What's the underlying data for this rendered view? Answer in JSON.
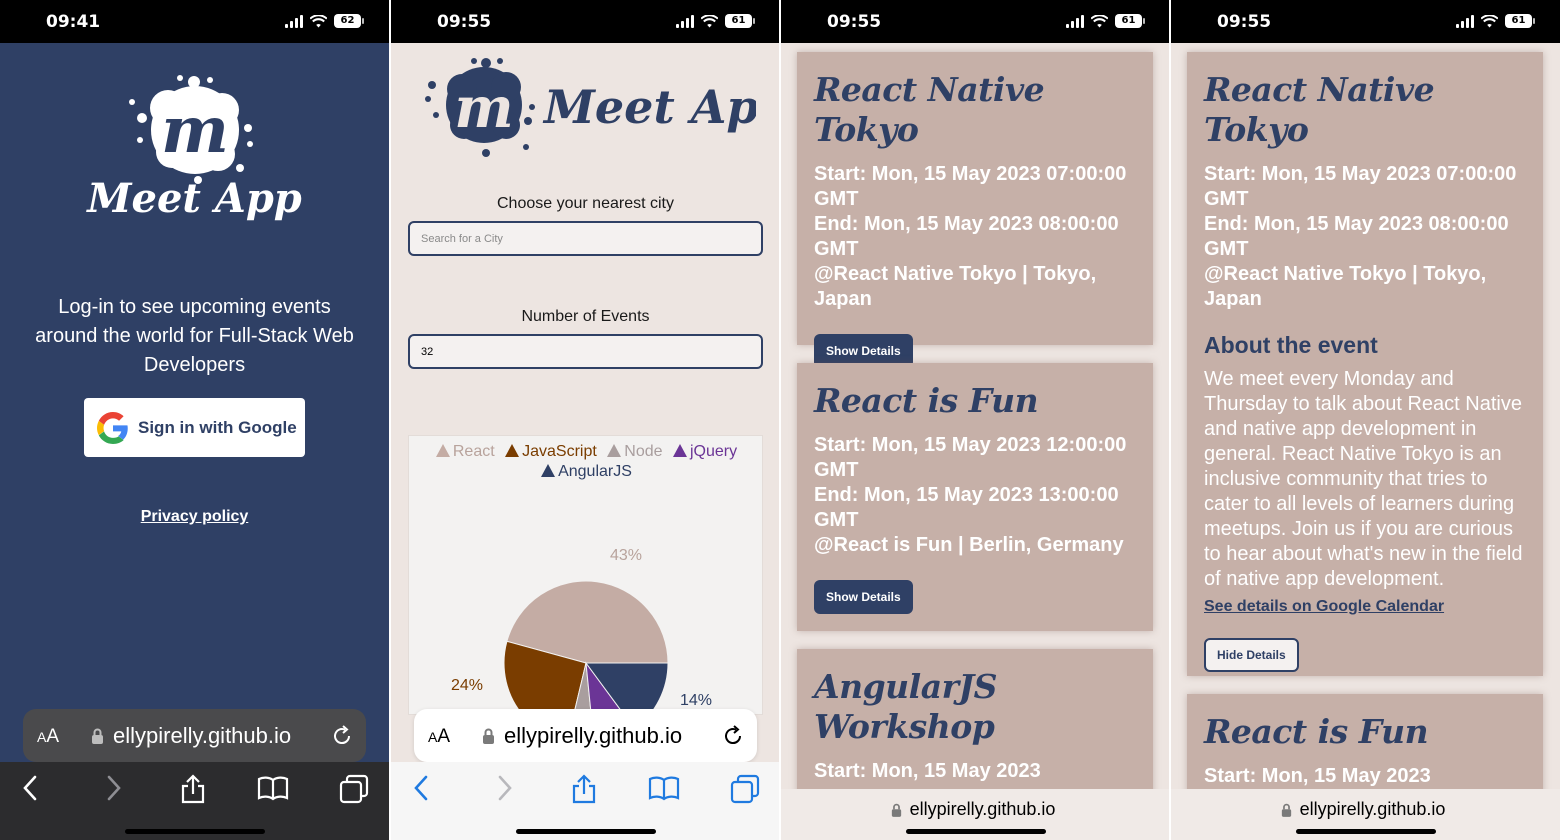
{
  "colors": {
    "navy": "#2f4065",
    "card": "#c6b0a8",
    "background": "#ede5e1",
    "react": "#c4aca4",
    "javascript": "#7a3d00",
    "node": "#a99e9e",
    "jquery": "#6b3596",
    "angularjs": "#2f4065"
  },
  "status": [
    {
      "time": "09:41",
      "battery": "62"
    },
    {
      "time": "09:55",
      "battery": "61"
    },
    {
      "time": "09:55",
      "battery": "61"
    },
    {
      "time": "09:55",
      "battery": "61"
    }
  ],
  "safari": {
    "aa": "A",
    "aa_big": "A",
    "url": "ellypirelly.github.io"
  },
  "login": {
    "logo_text": "Meet App",
    "text": "Log-in to see upcoming events around the world for Full-Stack Web Developers",
    "google_button": "Sign in with Google",
    "privacy": "Privacy policy"
  },
  "search": {
    "logo_text": "Meet App",
    "city_label": "Choose your nearest city",
    "city_placeholder": "Search for a City",
    "events_label": "Number of Events",
    "events_value": "32"
  },
  "chart_data": {
    "type": "pie",
    "legend": [
      "React",
      "JavaScript",
      "Node",
      "jQuery",
      "AngularJS"
    ],
    "values": [
      43,
      24,
      5,
      8,
      14
    ],
    "labels": [
      "43%",
      "24%",
      "14%"
    ]
  },
  "events": {
    "react_native_tokyo": {
      "title": "React Native Tokyo",
      "start": "Start: Mon, 15 May 2023 07:00:00 GMT",
      "end": "End: Mon, 15 May 2023 08:00:00 GMT",
      "location": "@React Native Tokyo | Tokyo, Japan"
    },
    "react_is_fun": {
      "title": "React is Fun",
      "start": "Start: Mon, 15 May 2023 12:00:00 GMT",
      "end": "End: Mon, 15 May 2023 13:00:00 GMT",
      "location": "@React is Fun | Berlin, Germany"
    },
    "angularjs_workshop": {
      "title": "AngularJS Workshop",
      "start": "Start: Mon, 15 May 2023"
    },
    "react_is_fun_short": {
      "start": "Start: Mon, 15 May 2023"
    },
    "show_details": "Show Details",
    "hide_details": "Hide Details",
    "about_heading": "About the event",
    "about_text": "We meet every Monday and Thursday to talk about React Native and native app development in general. React Native Tokyo is an inclusive community that tries to cater to all levels of learners during meetups. Join us if you are curious to hear about what's new in the field of native app development.",
    "gcal_link": "See details on Google Calendar"
  }
}
